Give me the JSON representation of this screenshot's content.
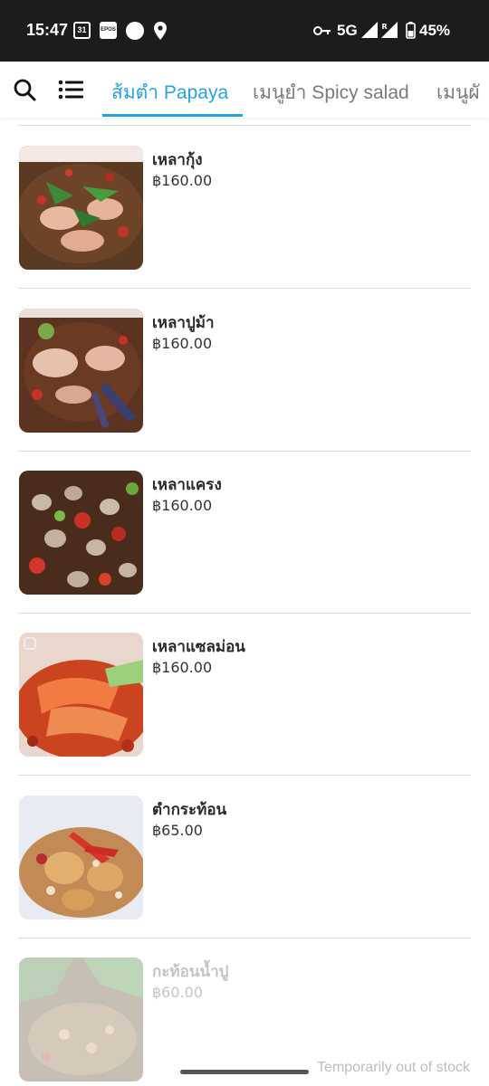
{
  "status_bar": {
    "time": "15:47",
    "calendar_day": "31",
    "app_badge": "EPOS",
    "network": "5G",
    "battery_percent": "45%"
  },
  "toolbar": {
    "search_icon": "search-icon",
    "menu_icon": "list-icon"
  },
  "tabs": [
    {
      "label": "ส้มตำ Papaya",
      "active": true
    },
    {
      "label": "เมนูยำ Spicy salad",
      "active": false
    },
    {
      "label": "เมนูผั",
      "active": false
    }
  ],
  "menu_items": [
    {
      "name": "เหลากุ้ง",
      "price": "฿160.00",
      "available": true
    },
    {
      "name": "เหลาปูม้า",
      "price": "฿160.00",
      "available": true
    },
    {
      "name": "เหลาแครง",
      "price": "฿160.00",
      "available": true
    },
    {
      "name": "เหลาแซลม่อน",
      "price": "฿160.00",
      "available": true
    },
    {
      "name": "ตำกระท้อน",
      "price": "฿65.00",
      "available": true
    },
    {
      "name": "กะท้อนน้ำปู",
      "price": "฿60.00",
      "available": false
    }
  ],
  "stock_notice": "Temporarily out of stock",
  "colors": {
    "accent": "#29a3e0",
    "status_bar_bg": "#1c1c1c",
    "muted_tab": "#7a7a7a",
    "divider": "#dddddd"
  }
}
